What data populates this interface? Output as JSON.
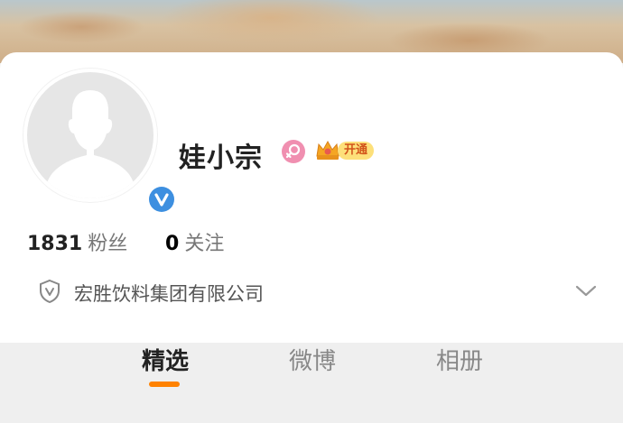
{
  "profile": {
    "name": "娃小宗",
    "vip_label": "开通"
  },
  "stats": {
    "followers_count": "1831",
    "followers_label": "粉丝",
    "following_count": "0",
    "following_label": "关注"
  },
  "company": {
    "name": "宏胜饮料集团有限公司"
  },
  "tabs": [
    {
      "label": "精选",
      "active": true
    },
    {
      "label": "微博",
      "active": false
    },
    {
      "label": "相册",
      "active": false
    }
  ],
  "colors": {
    "accent": "#ff8200",
    "verified": "#3d8fe0",
    "female_badge": "#f08fb0",
    "vip_badge": "#fde07a"
  },
  "icons": [
    "person-silhouette-icon",
    "verified-v-icon",
    "female-icon",
    "crown-icon",
    "shield-v-icon",
    "chevron-down-icon"
  ]
}
